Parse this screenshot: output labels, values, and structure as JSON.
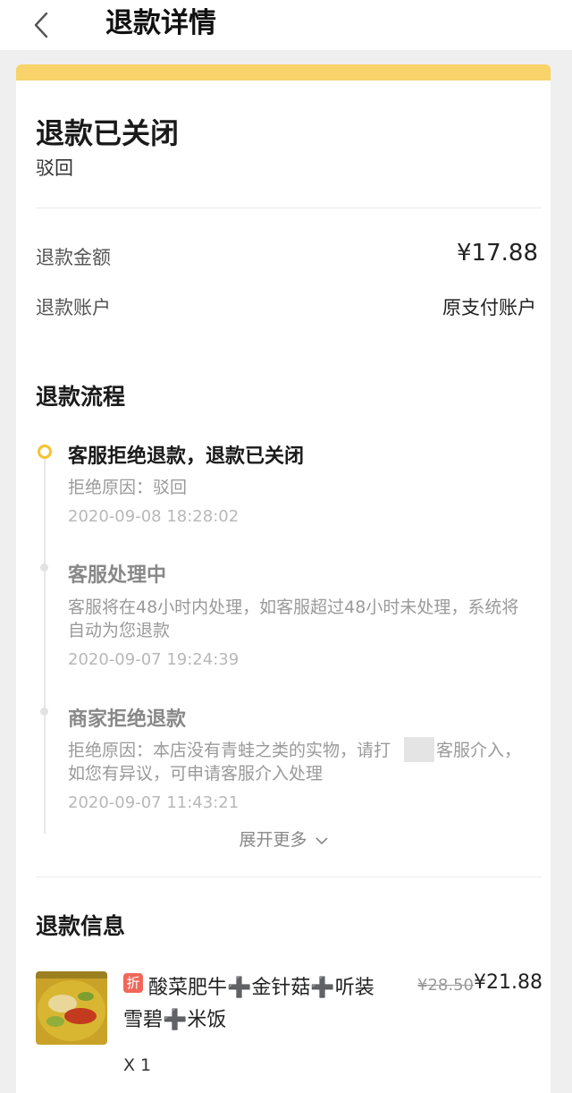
{
  "header": {
    "title": "退款详情"
  },
  "status": {
    "title": "退款已关闭",
    "subtitle": "驳回"
  },
  "refund_amount": {
    "label": "退款金额",
    "value": "¥17.88"
  },
  "refund_account": {
    "label": "退款账户",
    "value": "原支付账户"
  },
  "process": {
    "title": "退款流程",
    "steps": [
      {
        "title": "客服拒绝退款，退款已关闭",
        "detail": "拒绝原因：驳回",
        "time": "2020-09-08 18:28:02",
        "active": true
      },
      {
        "title": "客服处理中",
        "detail_lines": [
          "客服将在48小时内处理，如客服超过48小时未处理，系统将",
          "自动为您退款"
        ],
        "time": "2020-09-07 19:24:39",
        "active": false
      },
      {
        "title": "商家拒绝退款",
        "detail_lines": [
          "拒绝原因：本店没有青蛙之类的实物，请打",
          "客服介入，",
          "如您有异议，可申请客服介入处理"
        ],
        "time": "2020-09-07 11:43:21",
        "active": false
      }
    ],
    "expand_label": "展开更多"
  },
  "refund_info": {
    "title": "退款信息",
    "product": {
      "promo_badge": "折",
      "name_lines": [
        "酸菜肥牛➕金针菇➕听装",
        "雪碧➕米饭"
      ],
      "original_price": "¥28.50",
      "price": "¥21.88",
      "quantity": "X 1"
    }
  },
  "colors": {
    "accent": "#f5c230",
    "band": "#f7d36a",
    "promo": "#f0675a"
  },
  "icons": [
    "back-arrow-icon",
    "chevron-down-icon"
  ]
}
